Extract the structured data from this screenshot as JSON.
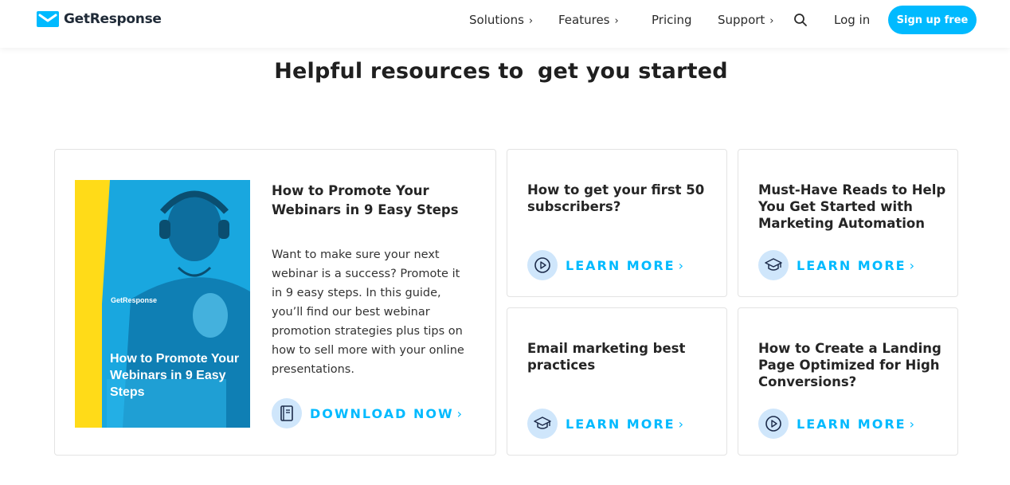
{
  "header": {
    "brand": "GetResponse",
    "nav": [
      {
        "label": "Solutions",
        "has_chevron": true
      },
      {
        "label": "Features",
        "has_chevron": true
      },
      {
        "label": "Pricing",
        "has_chevron": false
      },
      {
        "label": "Support",
        "has_chevron": true
      }
    ],
    "search_icon": "search-icon",
    "login": "Log in",
    "signup": "Sign up free"
  },
  "hero": {
    "title_plain": "Helpful resources to",
    "title_highlight": "get you started"
  },
  "featured": {
    "book_brand": "GetResponse",
    "book_title": "How to Promote Your Webinars in 9 Easy Steps",
    "title": "How to Promote Your Webinars in 9 Easy Steps",
    "description": "Want to make sure your next webinar is a success? Promote it in 9 easy steps. In this guide, you’ll find our best webinar promotion strategies plus tips on how to sell more with your online presentations.",
    "cta": "DOWNLOAD NOW",
    "cta_icon": "ebook-icon"
  },
  "cards": [
    {
      "title": "How to get your first 50 subscribers?",
      "cta": "LEARN MORE",
      "icon": "play-icon"
    },
    {
      "title": "Must-Have Reads to Help You Get Started with Marketing Automation",
      "cta": "LEARN MORE",
      "icon": "graduation-cap-icon"
    },
    {
      "title": "Email marketing best practices",
      "cta": "LEARN MORE",
      "icon": "graduation-cap-icon"
    },
    {
      "title": "How to Create a Landing Page Optimized for High Conversions?",
      "cta": "LEARN MORE",
      "icon": "play-icon"
    }
  ],
  "colors": {
    "accent": "#00baff",
    "highlight": "#ffe11b",
    "icon_bg": "#cfe6fb",
    "text": "#252525"
  }
}
